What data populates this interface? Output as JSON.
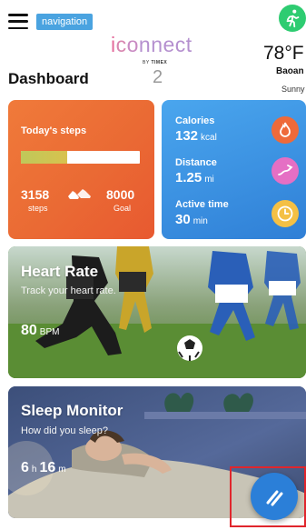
{
  "header": {
    "navigation_tag": "navigation",
    "logo": "iconnect",
    "logo_sub_by": "BY",
    "logo_sub_brand": "TIMEX",
    "page_number": "2",
    "title": "Dashboard"
  },
  "weather": {
    "temperature": "78°F",
    "city": "Baoan",
    "condition": "Sunny"
  },
  "steps_card": {
    "title": "Today's steps",
    "steps_value": "3158",
    "steps_label": "steps",
    "goal_value": "8000",
    "goal_label": "Goal",
    "progress_fraction": 0.39
  },
  "stats_card": {
    "calories_label": "Calories",
    "calories_value": "132",
    "calories_unit": "kcal",
    "distance_label": "Distance",
    "distance_value": "1.25",
    "distance_unit": "mi",
    "active_label": "Active time",
    "active_value": "30",
    "active_unit": "min"
  },
  "heart_card": {
    "title": "Heart Rate",
    "subtitle": "Track your heart rate.",
    "value": "80",
    "unit": "BPM"
  },
  "sleep_card": {
    "title": "Sleep Monitor",
    "subtitle": "How did you sleep?",
    "hours": "6",
    "hours_unit": "h",
    "minutes": "16",
    "minutes_unit": "m"
  },
  "colors": {
    "steps_card": "#ea6a34",
    "stats_card": "#3a8fe0",
    "fab": "#2b7fd8",
    "calories_icon": "#ee6a3a",
    "distance_icon": "#e56fc4",
    "active_icon": "#f4c045",
    "highlight": "#e0262d"
  },
  "icons": [
    "menu-icon",
    "running-person-icon",
    "sneakers-icon",
    "flame-icon",
    "route-icon",
    "clock-icon",
    "collapse-icon"
  ]
}
